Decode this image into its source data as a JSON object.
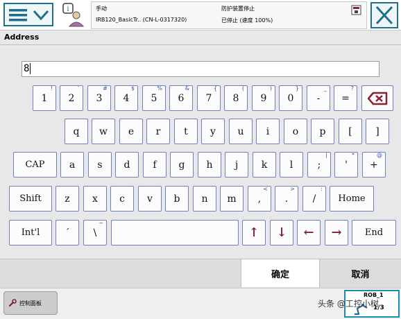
{
  "header": {
    "mode": "手动",
    "system": "IRB120_BasicTr.. (CN-L-0317320)",
    "guard_status": "防护装置停止",
    "run_status": "已停止 (速度 100%)"
  },
  "address": {
    "title": "Address",
    "value": "8"
  },
  "keyboard": {
    "row1": [
      {
        "label": "1",
        "shift": "!"
      },
      {
        "label": "2",
        "shift": "`"
      },
      {
        "label": "3",
        "shift": "#"
      },
      {
        "label": "4",
        "shift": "$"
      },
      {
        "label": "5",
        "shift": "%"
      },
      {
        "label": "6",
        "shift": "&"
      },
      {
        "label": "7",
        "shift": "{"
      },
      {
        "label": "8",
        "shift": "("
      },
      {
        "label": "9",
        "shift": ")"
      },
      {
        "label": "0",
        "shift": "}"
      },
      {
        "label": "-",
        "shift": "_"
      },
      {
        "label": "=",
        "shift": "?"
      }
    ],
    "row2": [
      "q",
      "w",
      "e",
      "r",
      "t",
      "y",
      "u",
      "i",
      "o",
      "p",
      "[",
      "]"
    ],
    "row3": {
      "cap": "CAP",
      "keys": [
        {
          "label": "a",
          "shift": ""
        },
        {
          "label": "s",
          "shift": ""
        },
        {
          "label": "d",
          "shift": ""
        },
        {
          "label": "f",
          "shift": ""
        },
        {
          "label": "g",
          "shift": ""
        },
        {
          "label": "h",
          "shift": ""
        },
        {
          "label": "j",
          "shift": ""
        },
        {
          "label": "k",
          "shift": ""
        },
        {
          "label": "l",
          "shift": ""
        },
        {
          "label": ";",
          "shift": "|"
        },
        {
          "label": "'",
          "shift": "*"
        },
        {
          "label": "+",
          "shift": "@"
        }
      ]
    },
    "row4": {
      "shift": "Shift",
      "keys": [
        {
          "label": "z",
          "shift": ""
        },
        {
          "label": "x",
          "shift": ""
        },
        {
          "label": "c",
          "shift": ""
        },
        {
          "label": "v",
          "shift": ""
        },
        {
          "label": "b",
          "shift": ""
        },
        {
          "label": "n",
          "shift": ""
        },
        {
          "label": "m",
          "shift": ""
        },
        {
          "label": ",",
          "shift": "<"
        },
        {
          "label": ".",
          "shift": ">"
        },
        {
          "label": "/",
          "shift": ":"
        }
      ],
      "home": "Home"
    },
    "row5": {
      "intl": "Int'l",
      "accent": "´",
      "backslash": "\\",
      "backslash_shift": "~",
      "up": "↑",
      "down": "↓",
      "left": "←",
      "right": "→",
      "end": "End"
    }
  },
  "actions": {
    "ok": "确定",
    "cancel": "取消"
  },
  "taskbar": {
    "control_panel": "控制面板",
    "rob": "ROB_1",
    "rob_value": "1/3",
    "watermark": "头条 @工控小树"
  },
  "colors": {
    "accent": "#1f6f8b",
    "key_border": "#6d7fbf",
    "arrow": "#7a1f3a",
    "backspace": "#8a1f2e"
  }
}
